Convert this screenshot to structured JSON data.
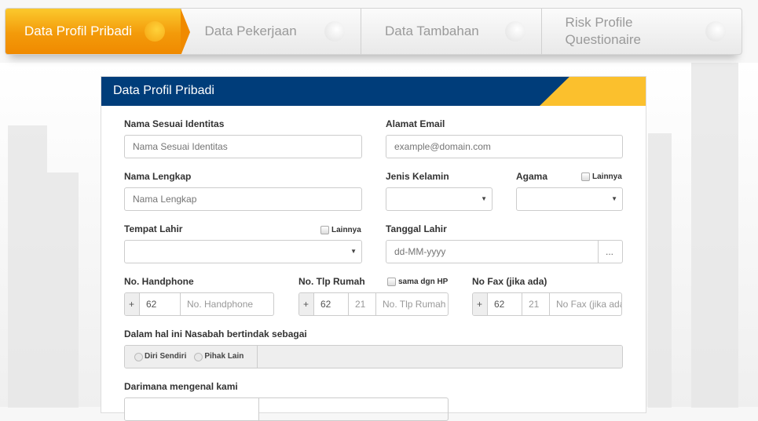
{
  "steps": [
    {
      "label": "Data Profil Pribadi",
      "active": true
    },
    {
      "label": "Data Pekerjaan"
    },
    {
      "label": "Data Tambahan"
    },
    {
      "label": "Risk Profile Questionaire"
    }
  ],
  "panel": {
    "title": "Data Profil Pribadi"
  },
  "form": {
    "nama_identitas": {
      "label": "Nama Sesuai Identitas",
      "placeholder": "Nama Sesuai Identitas"
    },
    "email": {
      "label": "Alamat Email",
      "placeholder": "example@domain.com"
    },
    "nama_lengkap": {
      "label": "Nama Lengkap",
      "placeholder": "Nama Lengkap"
    },
    "jenis_kelamin": {
      "label": "Jenis Kelamin",
      "value": ""
    },
    "agama": {
      "label": "Agama",
      "value": "",
      "lainnya": "Lainnya"
    },
    "tempat_lahir": {
      "label": "Tempat Lahir",
      "value": "",
      "lainnya": "Lainnya"
    },
    "tanggal_lahir": {
      "label": "Tanggal Lahir",
      "placeholder": "dd-MM-yyyy",
      "button": "..."
    },
    "handphone": {
      "label": "No. Handphone",
      "plus": "+",
      "country": "62",
      "placeholder": "No. Handphone"
    },
    "tlp_rumah": {
      "label": "No. Tlp Rumah",
      "same": "sama dgn HP",
      "plus": "+",
      "country": "62",
      "area": "21",
      "placeholder": "No. Tlp Rumah"
    },
    "fax": {
      "label": "No Fax (jika ada)",
      "plus": "+",
      "country": "62",
      "area": "21",
      "placeholder": "No Fax (jika ada)"
    },
    "bertindak": {
      "label": "Dalam hal ini Nasabah bertindak sebagai",
      "options": [
        "Diri Sendiri",
        "Pihak Lain"
      ]
    },
    "mengenal": {
      "label": "Darimana mengenal kami"
    }
  }
}
